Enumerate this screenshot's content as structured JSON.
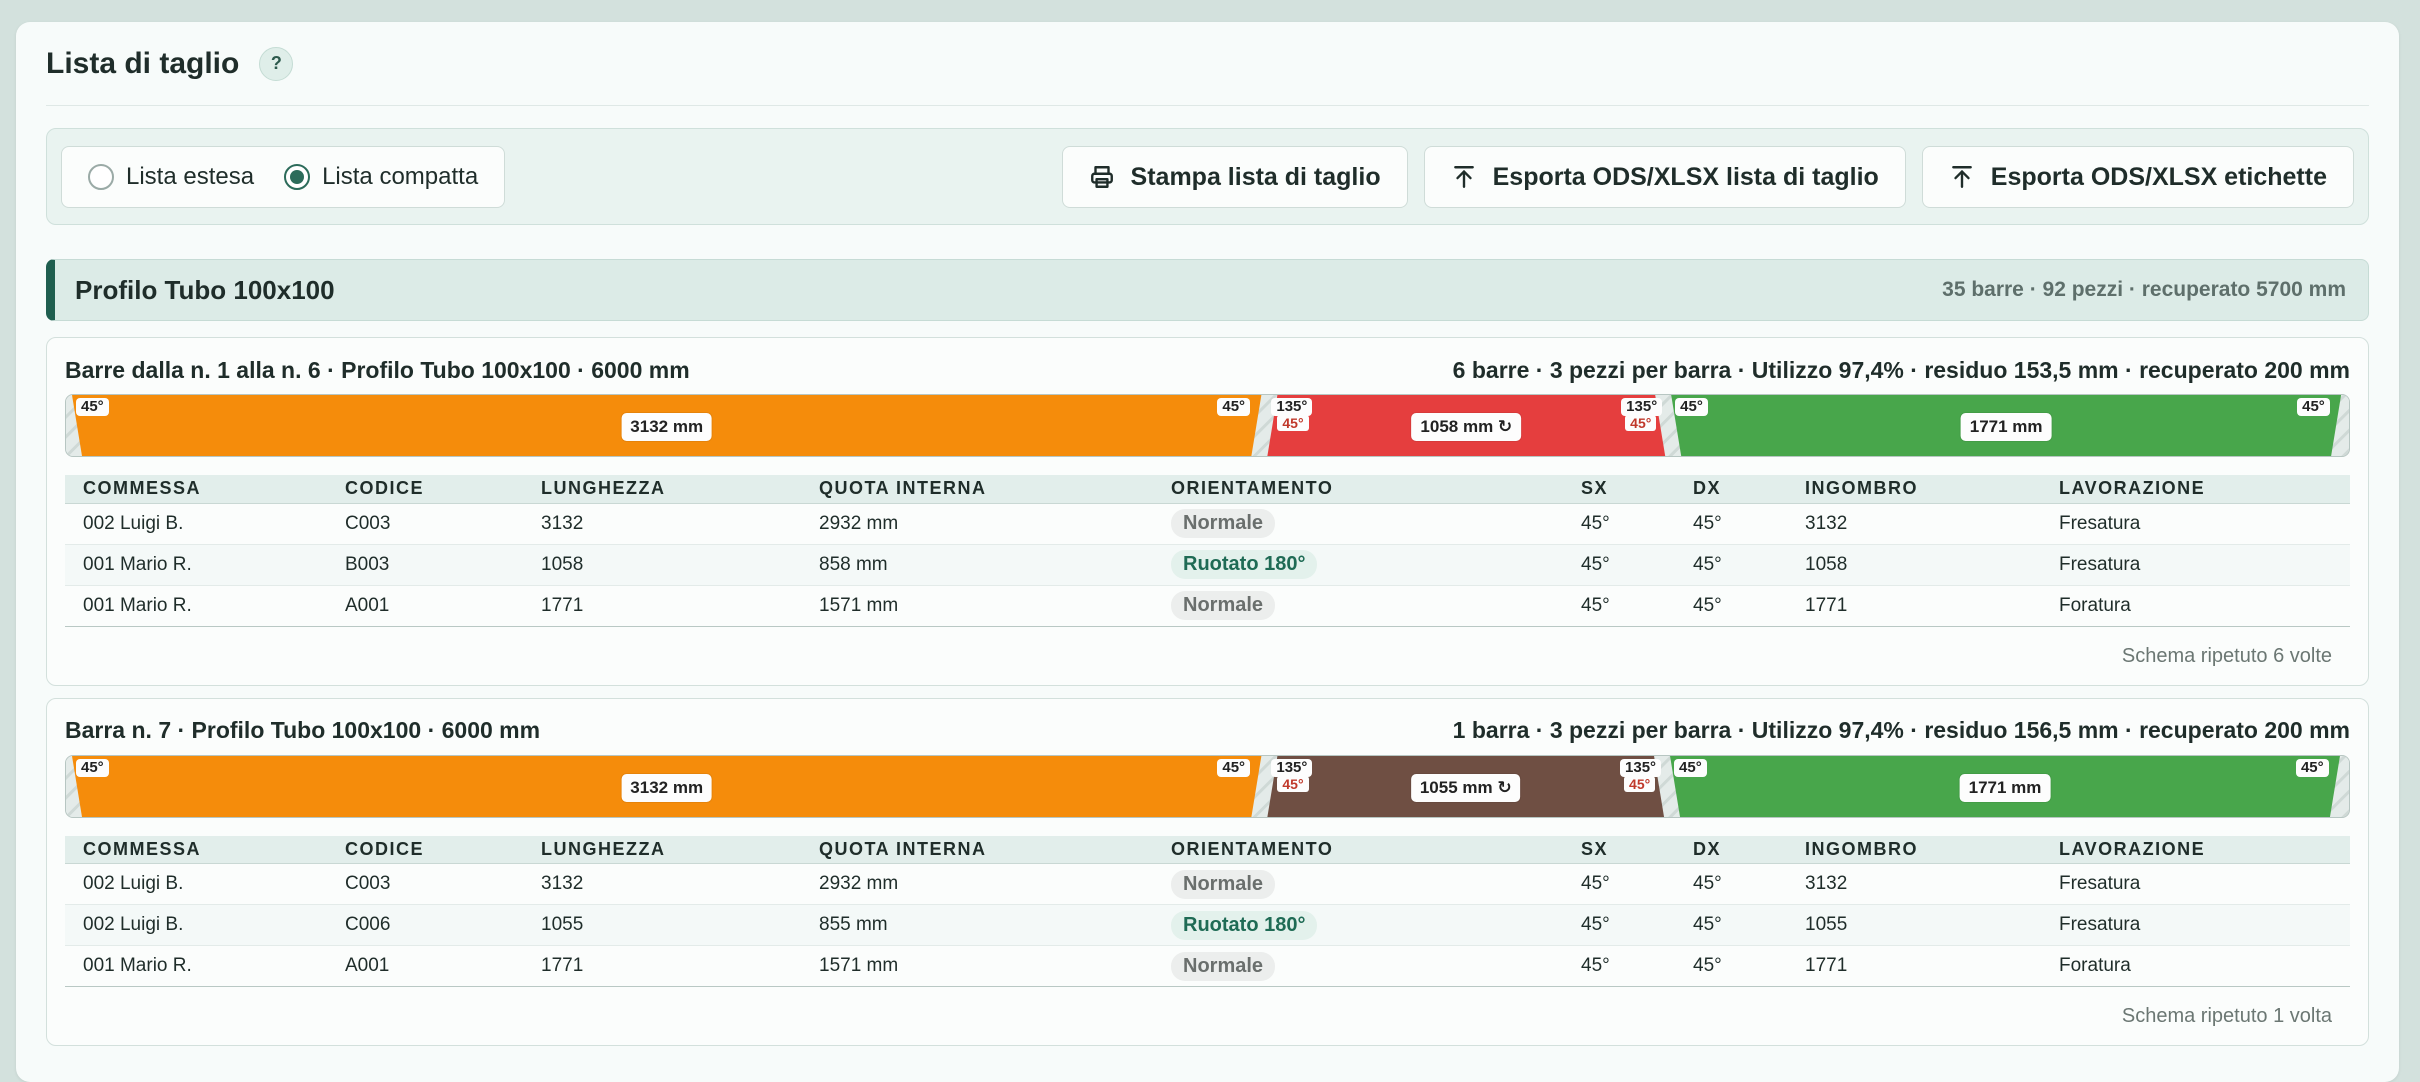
{
  "title": "Lista di taglio",
  "help_label": "?",
  "view_options": [
    {
      "label": "Lista estesa",
      "selected": false
    },
    {
      "label": "Lista compatta",
      "selected": true
    }
  ],
  "buttons": {
    "print": "Stampa lista di taglio",
    "export_list": "Esporta ODS/XLSX lista di taglio",
    "export_labels": "Esporta ODS/XLSX etichette"
  },
  "section": {
    "name": "Profilo Tubo 100x100",
    "stats": "35 barre · 92 pezzi · recuperato 5700 mm"
  },
  "columns": [
    "COMMESSA",
    "CODICE",
    "LUNGHEZZA",
    "QUOTA INTERNA",
    "ORIENTAMENTO",
    "SX",
    "DX",
    "INGOMBRO",
    "LAVORAZIONE"
  ],
  "groups": [
    {
      "title": "Barre dalla n. 1 alla n. 6 · Profilo Tubo 100x100 · 6000 mm",
      "summary": "6 barre · 3 pezzi per barra · Utilizzo 97,4% · residuo 153,5 mm · recuperato 200 mm",
      "bar_length_mm": 6000,
      "segments": [
        {
          "length_mm": 3132,
          "label": "3132 mm",
          "color": "#f58c0b",
          "left_angle": "45°",
          "right_angle": "45°",
          "left_angle2": "",
          "right_angle2": ""
        },
        {
          "length_mm": 1058,
          "label": "1058 mm ↻",
          "color": "#e53e3e",
          "left_angle": "135°",
          "right_angle": "135°",
          "left_angle2": "45°",
          "right_angle2": "45°"
        },
        {
          "length_mm": 1771,
          "label": "1771 mm",
          "color": "#48a64b",
          "left_angle": "45°",
          "right_angle": "45°",
          "left_angle2": "",
          "right_angle2": ""
        }
      ],
      "rows": [
        {
          "commessa": "002 Luigi B.",
          "codice": "C003",
          "lunghezza": "3132",
          "quota": "2932 mm",
          "orientamento": "Normale",
          "rotated": false,
          "sx": "45°",
          "dx": "45°",
          "ingombro": "3132",
          "lavorazione": "Fresatura"
        },
        {
          "commessa": "001 Mario R.",
          "codice": "B003",
          "lunghezza": "1058",
          "quota": "858 mm",
          "orientamento": "Ruotato 180°",
          "rotated": true,
          "sx": "45°",
          "dx": "45°",
          "ingombro": "1058",
          "lavorazione": "Fresatura"
        },
        {
          "commessa": "001 Mario R.",
          "codice": "A001",
          "lunghezza": "1771",
          "quota": "1571 mm",
          "orientamento": "Normale",
          "rotated": false,
          "sx": "45°",
          "dx": "45°",
          "ingombro": "1771",
          "lavorazione": "Foratura"
        }
      ],
      "repeat": "Schema ripetuto 6 volte"
    },
    {
      "title": "Barra n. 7 · Profilo Tubo 100x100 · 6000 mm",
      "summary": "1 barra · 3 pezzi per barra · Utilizzo 97,4% · residuo 156,5 mm · recuperato 200 mm",
      "bar_length_mm": 6000,
      "segments": [
        {
          "length_mm": 3132,
          "label": "3132 mm",
          "color": "#f58c0b",
          "left_angle": "45°",
          "right_angle": "45°",
          "left_angle2": "",
          "right_angle2": ""
        },
        {
          "length_mm": 1055,
          "label": "1055 mm ↻",
          "color": "#6f4f43",
          "left_angle": "135°",
          "right_angle": "135°",
          "left_angle2": "45°",
          "right_angle2": "45°"
        },
        {
          "length_mm": 1771,
          "label": "1771 mm",
          "color": "#48a64b",
          "left_angle": "45°",
          "right_angle": "45°",
          "left_angle2": "",
          "right_angle2": ""
        }
      ],
      "rows": [
        {
          "commessa": "002 Luigi B.",
          "codice": "C003",
          "lunghezza": "3132",
          "quota": "2932 mm",
          "orientamento": "Normale",
          "rotated": false,
          "sx": "45°",
          "dx": "45°",
          "ingombro": "3132",
          "lavorazione": "Fresatura"
        },
        {
          "commessa": "002 Luigi B.",
          "codice": "C006",
          "lunghezza": "1055",
          "quota": "855 mm",
          "orientamento": "Ruotato 180°",
          "rotated": true,
          "sx": "45°",
          "dx": "45°",
          "ingombro": "1055",
          "lavorazione": "Fresatura"
        },
        {
          "commessa": "001 Mario R.",
          "codice": "A001",
          "lunghezza": "1771",
          "quota": "1571 mm",
          "orientamento": "Normale",
          "rotated": false,
          "sx": "45°",
          "dx": "45°",
          "ingombro": "1771",
          "lavorazione": "Foratura"
        }
      ],
      "repeat": "Schema ripetuto 1 volta"
    }
  ]
}
